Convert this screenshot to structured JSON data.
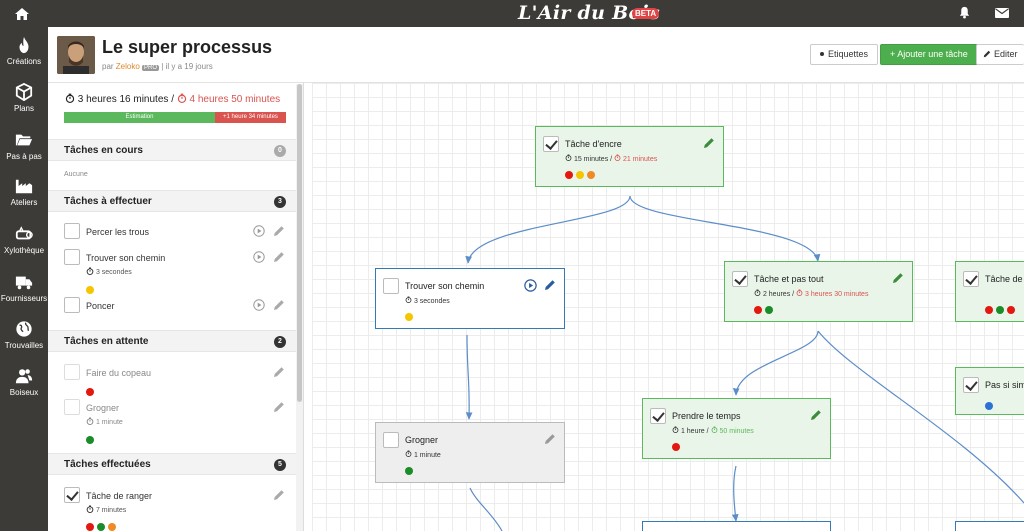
{
  "topbar": {
    "brand": "L'Air du Bois",
    "badge": "BETA"
  },
  "nav": [
    {
      "label": "Créations",
      "icon": "flame-icon"
    },
    {
      "label": "Plans",
      "icon": "cube-icon"
    },
    {
      "label": "Pas à pas",
      "icon": "folder-icon"
    },
    {
      "label": "Ateliers",
      "icon": "factory-icon"
    },
    {
      "label": "Xylothèque",
      "icon": "log-icon"
    },
    {
      "label": "Fournisseurs",
      "icon": "truck-icon"
    },
    {
      "label": "Trouvailles",
      "icon": "globe-icon"
    },
    {
      "label": "Boiseux",
      "icon": "users-icon"
    }
  ],
  "header": {
    "title": "Le super processus",
    "by": "par",
    "user": "Zeloko",
    "pro": "PRO",
    "ago": "il y a 19 jours",
    "labels_button": "Etiquettes",
    "add_button": "+ Ajouter une tâche",
    "edit_button": "Editer"
  },
  "summary": {
    "actual": "3 heures 16 minutes",
    "sep": "/",
    "estimated": "4 heures 50 minutes",
    "bar_estimation": "Estimation",
    "bar_over": "+1 heure 34 minutes",
    "estimation_fraction": 0.68
  },
  "colors": {
    "red": "#e3180e",
    "yellow": "#f5c500",
    "orange": "#f08a24",
    "green": "#1a8c2a",
    "blue": "#2a72d4"
  },
  "sections": {
    "in_progress": {
      "label": "Tâches en cours",
      "count": "0",
      "empty": "Aucune"
    },
    "todo": {
      "label": "Tâches à effectuer",
      "count": "3",
      "tasks": [
        {
          "name": "Percer les trous"
        },
        {
          "name": "Trouver son chemin",
          "time": "3 secondes",
          "dots": [
            "yellow"
          ]
        },
        {
          "name": "Poncer"
        }
      ]
    },
    "waiting": {
      "label": "Tâches en attente",
      "count": "2",
      "tasks": [
        {
          "name": "Faire du copeau",
          "dots": [
            "red"
          ]
        },
        {
          "name": "Grogner",
          "time": "1 minute",
          "dots": [
            "green"
          ]
        }
      ]
    },
    "done": {
      "label": "Tâches effectuées",
      "count": "5",
      "tasks": [
        {
          "name": "Tâche de ranger",
          "time": "7 minutes",
          "dots": [
            "red",
            "green",
            "orange"
          ]
        }
      ]
    }
  },
  "graph": {
    "n1": {
      "title": "Tâche d'encre",
      "time": "15 minutes",
      "sep": "/",
      "est": "21 minutes"
    },
    "n2": {
      "title": "Trouver son chemin",
      "time": "3 secondes"
    },
    "n3": {
      "title": "Tâche et pas tout",
      "time": "2 heures",
      "sep": "/",
      "est": "3 heures 30 minutes"
    },
    "n4": {
      "title": "Tâche de"
    },
    "n5": {
      "title": "Grogner",
      "time": "1 minute"
    },
    "n6": {
      "title": "Prendre le temps",
      "time": "1 heure",
      "sep": "/",
      "est": "50 minutes"
    },
    "n7": {
      "title": "Pas si sim"
    }
  }
}
